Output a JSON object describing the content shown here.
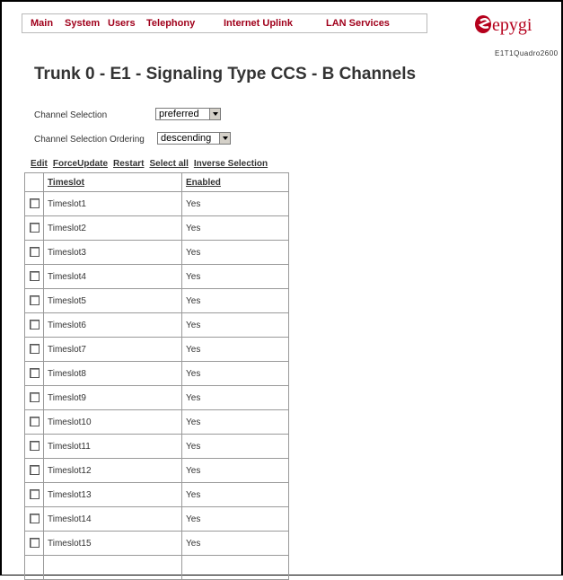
{
  "menu": [
    "Main",
    "System",
    "Users",
    "Telephony",
    "Internet Uplink",
    "LAN Services"
  ],
  "logo": {
    "brand": "epygi",
    "model": "E1T1Quadro2600"
  },
  "title": "Trunk 0 - E1 - Signaling Type CCS - B Channels",
  "settings": {
    "channel_selection_label": "Channel Selection",
    "channel_selection_value": "preferred",
    "ordering_label": "Channel Selection Ordering",
    "ordering_value": "descending"
  },
  "actions": [
    "Edit",
    "ForceUpdate",
    "Restart",
    "Select all",
    "Inverse Selection"
  ],
  "table": {
    "headers": [
      "Timeslot",
      "Enabled"
    ],
    "rows": [
      [
        "Timeslot1",
        "Yes"
      ],
      [
        "Timeslot2",
        "Yes"
      ],
      [
        "Timeslot3",
        "Yes"
      ],
      [
        "Timeslot4",
        "Yes"
      ],
      [
        "Timeslot5",
        "Yes"
      ],
      [
        "Timeslot6",
        "Yes"
      ],
      [
        "Timeslot7",
        "Yes"
      ],
      [
        "Timeslot8",
        "Yes"
      ],
      [
        "Timeslot9",
        "Yes"
      ],
      [
        "Timeslot10",
        "Yes"
      ],
      [
        "Timeslot11",
        "Yes"
      ],
      [
        "Timeslot12",
        "Yes"
      ],
      [
        "Timeslot13",
        "Yes"
      ],
      [
        "Timeslot14",
        "Yes"
      ],
      [
        "Timeslot15",
        "Yes"
      ]
    ]
  },
  "colors": {
    "menu": "#a0001b",
    "logo": "#b5001c",
    "text": "#333333"
  }
}
